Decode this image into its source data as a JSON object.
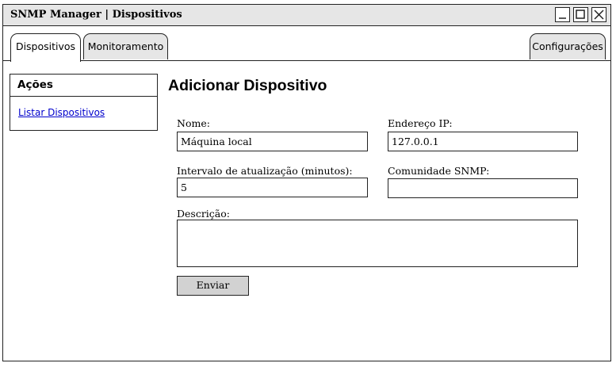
{
  "window": {
    "title": "SNMP Manager | Dispositivos"
  },
  "tabs": [
    {
      "label": "Dispositivos",
      "active": true
    },
    {
      "label": "Monitoramento",
      "active": false
    },
    {
      "label": "Configurações",
      "active": false
    }
  ],
  "sidebar": {
    "header": "Ações",
    "links": [
      {
        "label": "Listar Dispositivos"
      }
    ]
  },
  "main": {
    "title": "Adicionar Dispositivo",
    "form": {
      "name": {
        "label": "Nome:",
        "value": "Máquina local"
      },
      "ip": {
        "label": "Endereço IP:",
        "value": "127.0.0.1"
      },
      "interval": {
        "label": "Intervalo de atualização (minutos):",
        "value": "5"
      },
      "community": {
        "label": "Comunidade SNMP:",
        "value": ""
      },
      "description": {
        "label": "Descrição:",
        "value": ""
      },
      "submit_label": "Enviar"
    }
  },
  "icons": {
    "minimize": "minimize-icon",
    "maximize": "maximize-icon",
    "close": "close-icon"
  }
}
